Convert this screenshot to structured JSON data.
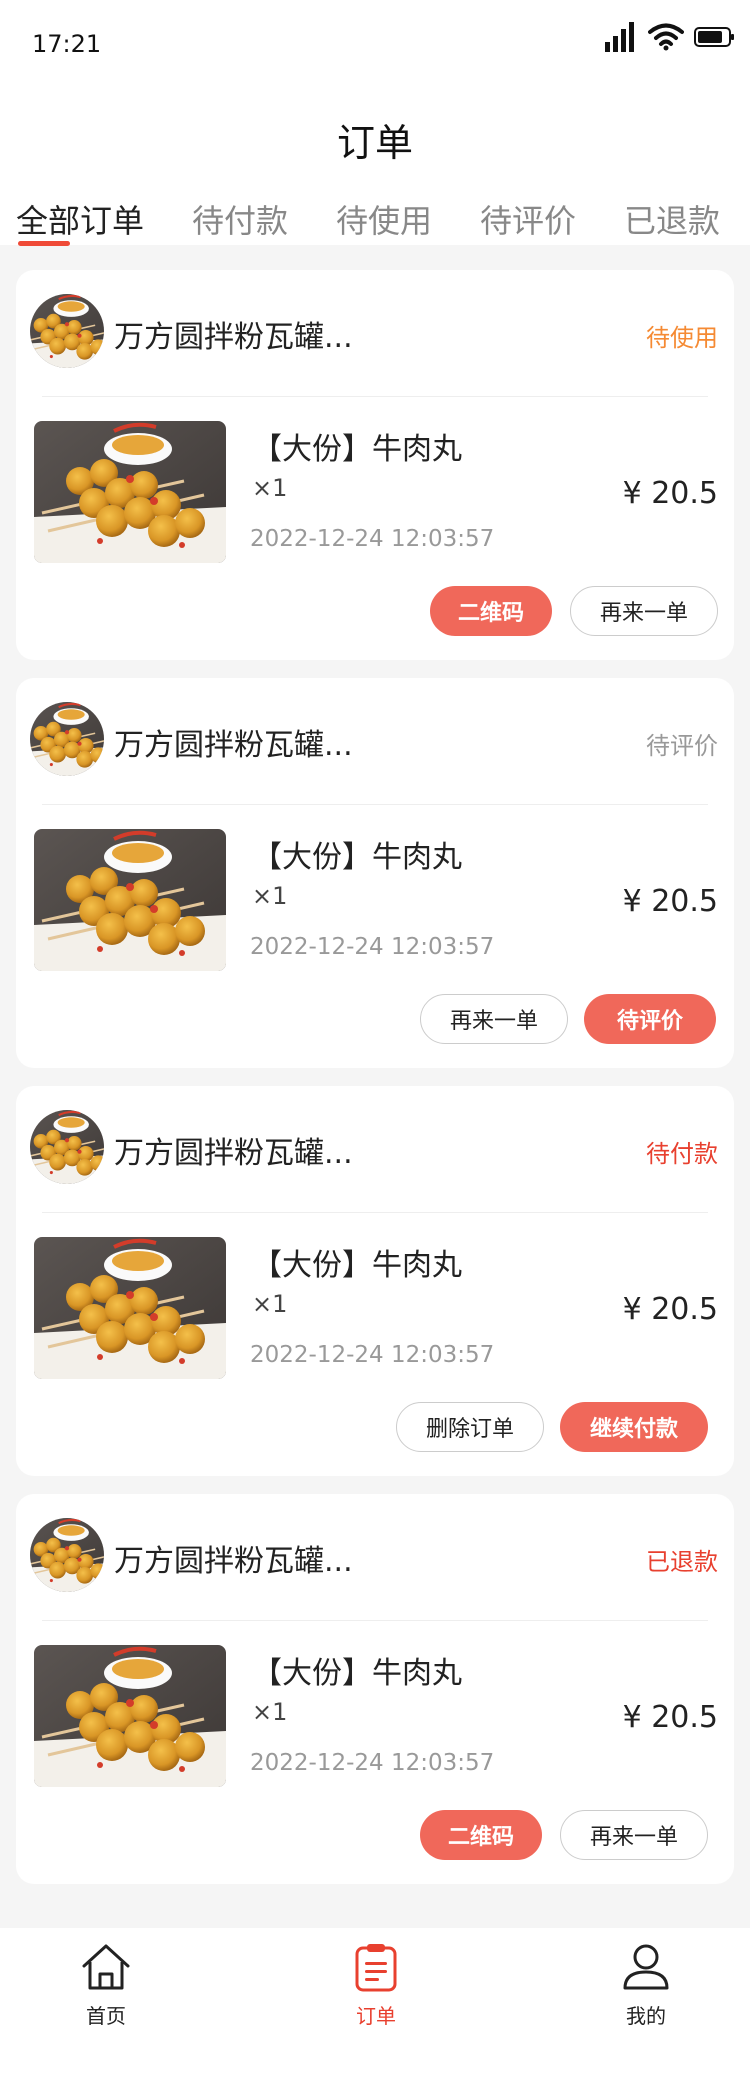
{
  "status_bar": {
    "time": "17:21"
  },
  "header": {
    "title": "订单"
  },
  "tabs": [
    {
      "label": "全部订单",
      "active": true
    },
    {
      "label": "待付款"
    },
    {
      "label": "待使用"
    },
    {
      "label": "待评价"
    },
    {
      "label": "已退款"
    }
  ],
  "colors": {
    "accent": "#f0685a",
    "active_tab_underline": "#ef4a37",
    "status_orange": "#f58a33",
    "status_red": "#e8402f",
    "status_gray": "#999999"
  },
  "orders": [
    {
      "shop": "万方圆拌粉瓦罐...",
      "status": "待使用",
      "product": "【大份】牛肉丸",
      "qty": "×1",
      "price": "¥ 20.5",
      "date": "2022-12-24 12:03:57",
      "buttons": [
        "二维码",
        "再来一单"
      ]
    },
    {
      "shop": "万方圆拌粉瓦罐...",
      "status": "待评价",
      "product": "【大份】牛肉丸",
      "qty": "×1",
      "price": "¥ 20.5",
      "date": "2022-12-24 12:03:57",
      "buttons": [
        "再来一单",
        "待评价"
      ]
    },
    {
      "shop": "万方圆拌粉瓦罐...",
      "status": "待付款",
      "product": "【大份】牛肉丸",
      "qty": "×1",
      "price": "¥ 20.5",
      "date": "2022-12-24 12:03:57",
      "buttons": [
        "删除订单",
        "继续付款"
      ]
    },
    {
      "shop": "万方圆拌粉瓦罐...",
      "status": "已退款",
      "product": "【大份】牛肉丸",
      "qty": "×1",
      "price": "¥ 20.5",
      "date": "2022-12-24 12:03:57",
      "buttons": [
        "二维码",
        "再来一单"
      ]
    }
  ],
  "bottom_nav": [
    {
      "label": "首页",
      "icon": "home-icon"
    },
    {
      "label": "订单",
      "icon": "clipboard-icon",
      "active": true
    },
    {
      "label": "我的",
      "icon": "user-icon"
    }
  ]
}
